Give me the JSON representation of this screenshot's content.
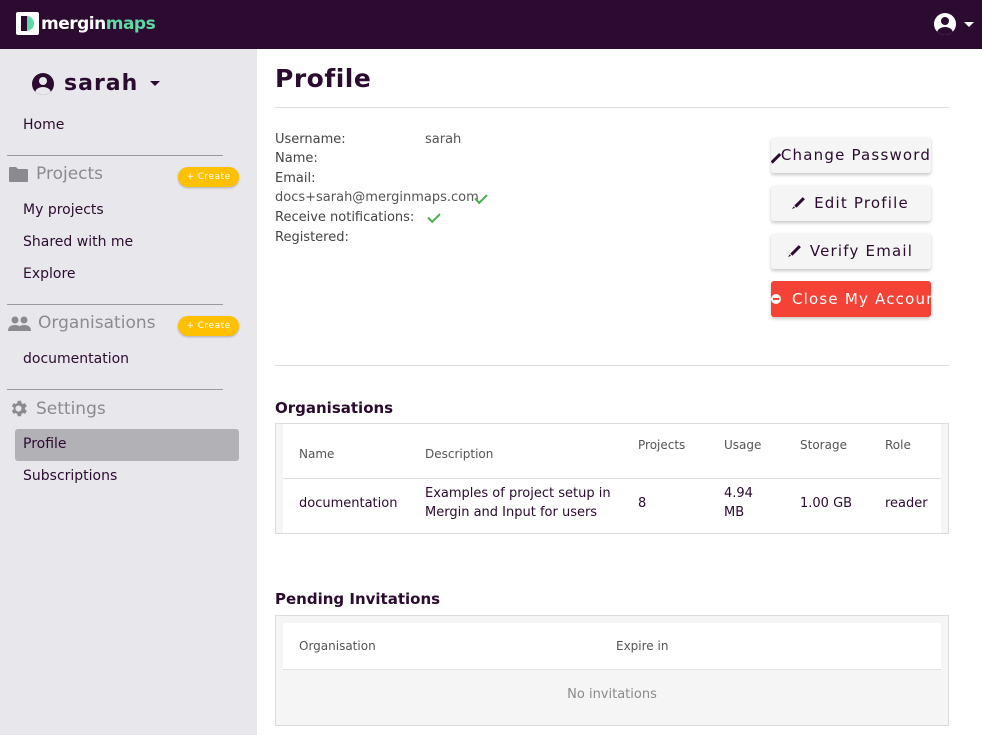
{
  "app": {
    "logo_part1": "mergin",
    "logo_part2": "maps"
  },
  "sidebar": {
    "username": "sarah",
    "home": "Home",
    "projects": {
      "title": "Projects",
      "create": "+ Create",
      "items": [
        "My projects",
        "Shared with me",
        "Explore"
      ]
    },
    "organisations": {
      "title": "Organisations",
      "create": "+ Create",
      "items": [
        "documentation"
      ]
    },
    "settings": {
      "title": "Settings",
      "items": [
        "Profile",
        "Subscriptions"
      ]
    }
  },
  "profile": {
    "title": "Profile",
    "labels": {
      "username": "Username:",
      "name": "Name:",
      "email": "Email:",
      "notifications": "Receive notifications:",
      "registered": "Registered:"
    },
    "username": "sarah",
    "email": "docs+sarah@merginmaps.com"
  },
  "actions": {
    "change_password": "Change Password",
    "edit_profile": "Edit Profile",
    "verify_email": "Verify Email",
    "close_account": "Close My Account"
  },
  "organisations": {
    "title": "Organisations",
    "headers": [
      "Name",
      "Description",
      "Projects",
      "Usage",
      "Storage",
      "Role"
    ],
    "rows": [
      {
        "name": "documentation",
        "description_line1": "Examples of project setup in",
        "description_line2": "Mergin and Input for users",
        "projects": "8",
        "usage_line1": "4.94",
        "usage_line2": "MB",
        "storage": "1.00 GB",
        "role": "reader"
      }
    ]
  },
  "invitations": {
    "title": "Pending Invitations",
    "headers": [
      "Organisation",
      "Expire in"
    ],
    "empty": "No invitations"
  },
  "colors": {
    "primary": "#2b0b2f",
    "accent": "#5fd8a4",
    "create_pill": "#ffc000",
    "danger": "#f44336",
    "check": "#4caf50"
  }
}
